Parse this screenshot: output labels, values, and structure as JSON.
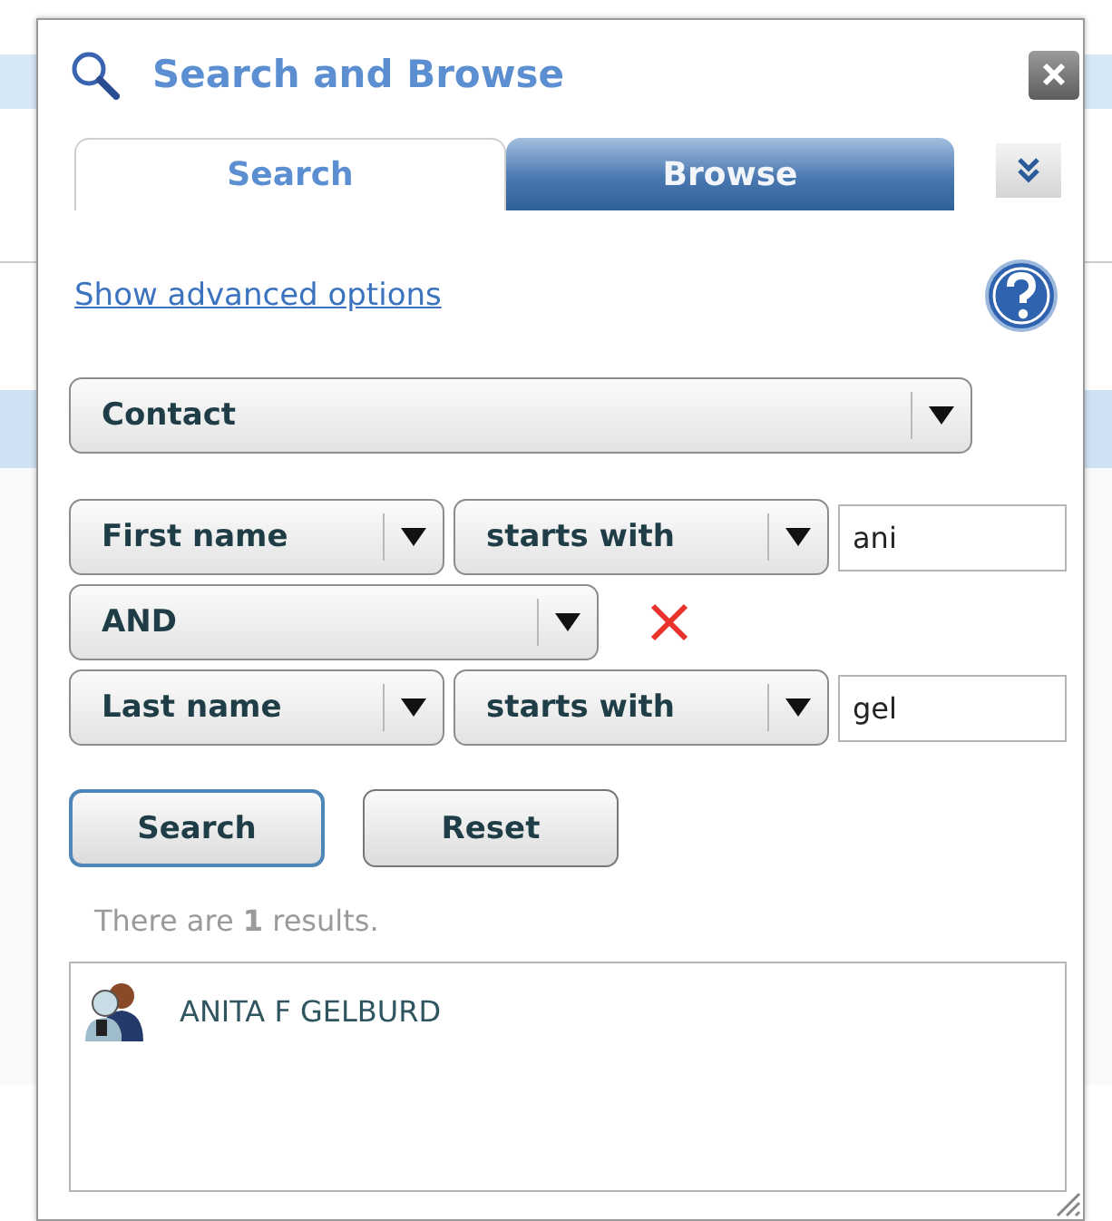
{
  "dialog": {
    "title": "Search and Browse",
    "tabs": [
      {
        "label": "Search",
        "selected": true
      },
      {
        "label": "Browse",
        "selected": false
      }
    ],
    "advanced_link": "Show advanced options",
    "entity": {
      "value": "Contact"
    },
    "criteria": [
      {
        "kind": "condition",
        "field": "First name",
        "operator": "starts with",
        "value": "ani"
      },
      {
        "kind": "connector",
        "value": "AND"
      },
      {
        "kind": "condition",
        "field": "Last name",
        "operator": "starts with",
        "value": "gel"
      }
    ],
    "buttons": [
      {
        "label": "Search",
        "focused": true
      },
      {
        "label": "Reset",
        "focused": false
      }
    ],
    "results_summary": "There are **1** results.",
    "results": [
      {
        "name": "ANITA F GELBURD"
      }
    ]
  }
}
